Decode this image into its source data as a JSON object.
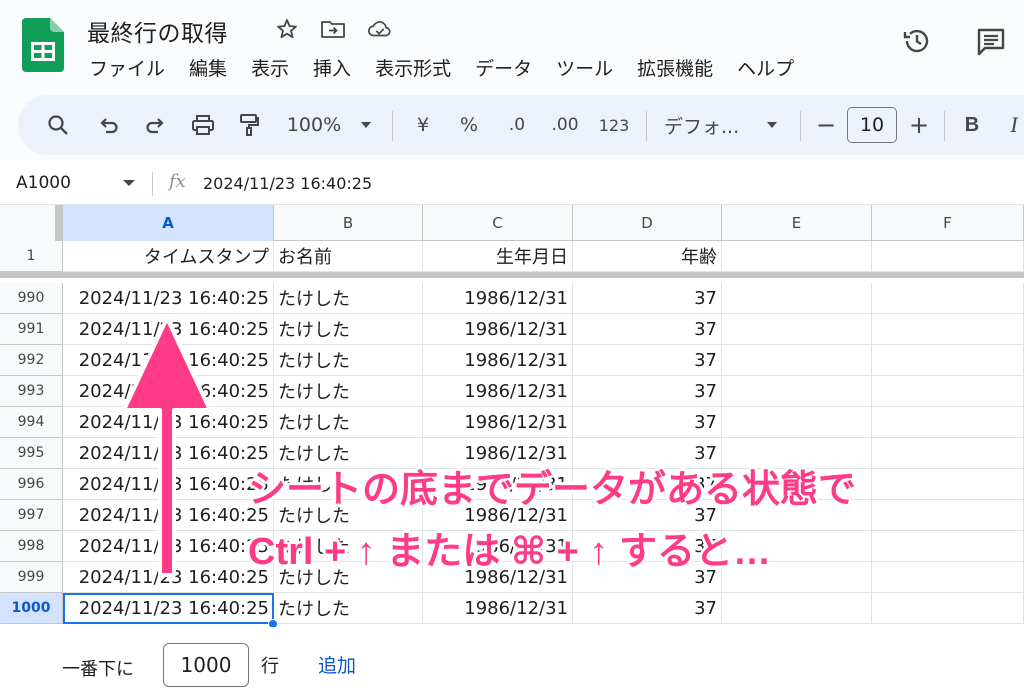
{
  "header": {
    "title": "最終行の取得",
    "menu": [
      "ファイル",
      "編集",
      "表示",
      "挿入",
      "表示形式",
      "データ",
      "ツール",
      "拡張機能",
      "ヘルプ"
    ]
  },
  "toolbar": {
    "zoom": "100%",
    "currency": "¥",
    "percent": "%",
    "dec_decrease": ".0",
    "dec_increase": ".00",
    "number_format": "123",
    "font": "デフォ...",
    "font_size": "10",
    "bold": "B",
    "minus": "−",
    "plus": "+"
  },
  "formula_bar": {
    "cell_ref": "A1000",
    "fx": "fx",
    "value": "2024/11/23 16:40:25"
  },
  "grid": {
    "columns": [
      "A",
      "B",
      "C",
      "D",
      "E",
      "F"
    ],
    "header_row": {
      "number": "1",
      "cells": [
        "タイムスタンプ",
        "お名前",
        "生年月日",
        "年齢",
        "",
        ""
      ]
    },
    "rows": [
      {
        "number": "990",
        "cells": [
          "2024/11/23 16:40:25",
          "たけした",
          "1986/12/31",
          "37"
        ]
      },
      {
        "number": "991",
        "cells": [
          "2024/11/23 16:40:25",
          "たけした",
          "1986/12/31",
          "37"
        ]
      },
      {
        "number": "992",
        "cells": [
          "2024/11/23 16:40:25",
          "たけした",
          "1986/12/31",
          "37"
        ]
      },
      {
        "number": "993",
        "cells": [
          "2024/11/23 16:40:25",
          "たけした",
          "1986/12/31",
          "37"
        ]
      },
      {
        "number": "994",
        "cells": [
          "2024/11/23 16:40:25",
          "たけした",
          "1986/12/31",
          "37"
        ]
      },
      {
        "number": "995",
        "cells": [
          "2024/11/23 16:40:25",
          "たけした",
          "1986/12/31",
          "37"
        ]
      },
      {
        "number": "996",
        "cells": [
          "2024/11/23 16:40:25",
          "たけした",
          "1986/12/31",
          "37"
        ]
      },
      {
        "number": "997",
        "cells": [
          "2024/11/23 16:40:25",
          "たけした",
          "1986/12/31",
          "37"
        ]
      },
      {
        "number": "998",
        "cells": [
          "2024/11/23 16:40:25",
          "たけした",
          "1986/12/31",
          "37"
        ]
      },
      {
        "number": "999",
        "cells": [
          "2024/11/23 16:40:25",
          "たけした",
          "1986/12/31",
          "37"
        ]
      },
      {
        "number": "1000",
        "cells": [
          "2024/11/23 16:40:25",
          "たけした",
          "1986/12/31",
          "37"
        ]
      }
    ]
  },
  "add_rows": {
    "label": "一番下に",
    "count": "1000",
    "unit": "行",
    "button": "追加"
  },
  "annotation": {
    "line1": "シートの底までデータがある状態で",
    "line2": "Ctrl + ↑ または ⌘ + ↑ すると…"
  },
  "colors": {
    "accent": "#1a73e8",
    "annotation": "#ff3b87",
    "toolbar_bg": "#edf2fa",
    "sheets_green": "#0f9d58"
  }
}
